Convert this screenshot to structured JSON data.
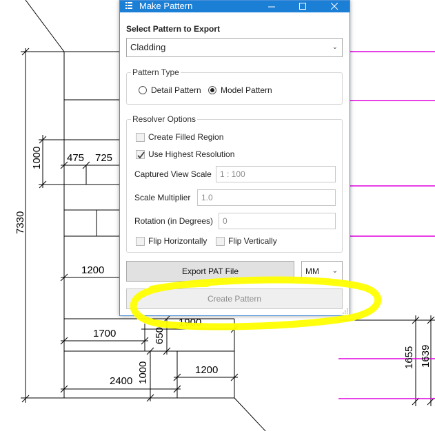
{
  "window": {
    "title": "Make Pattern"
  },
  "export": {
    "heading": "Select Pattern to Export",
    "selected_pattern": "Cladding"
  },
  "pattern_type": {
    "title": "Pattern Type",
    "options": [
      "Detail Pattern",
      "Model Pattern"
    ],
    "selected": "Model Pattern"
  },
  "resolver": {
    "title": "Resolver Options",
    "create_filled_region": {
      "label": "Create Filled Region",
      "checked": false
    },
    "use_highest_resolution": {
      "label": "Use Highest Resolution",
      "checked": true
    },
    "captured_view_scale": {
      "label": "Captured View Scale",
      "value": "1 : 100"
    },
    "scale_multiplier": {
      "label": "Scale Multiplier",
      "value": "1.0"
    },
    "rotation": {
      "label": "Rotation (in Degrees)",
      "value": "0"
    },
    "flip_horizontally": {
      "label": "Flip Horizontally",
      "checked": false
    },
    "flip_vertically": {
      "label": "Flip Vertically",
      "checked": false
    }
  },
  "actions": {
    "export_pat": "Export PAT File",
    "units": "MM",
    "create_pattern": "Create Pattern"
  },
  "drawing": {
    "dimensions": [
      "7330",
      "1000",
      "475",
      "725",
      "1200",
      "1900",
      "1700",
      "650",
      "2400",
      "1000",
      "1200",
      "1655",
      "1639"
    ]
  },
  "colors": {
    "titlebar": "#1c7fd6",
    "highlight": "#ffff00",
    "magenta_lines": "#e000e0"
  }
}
